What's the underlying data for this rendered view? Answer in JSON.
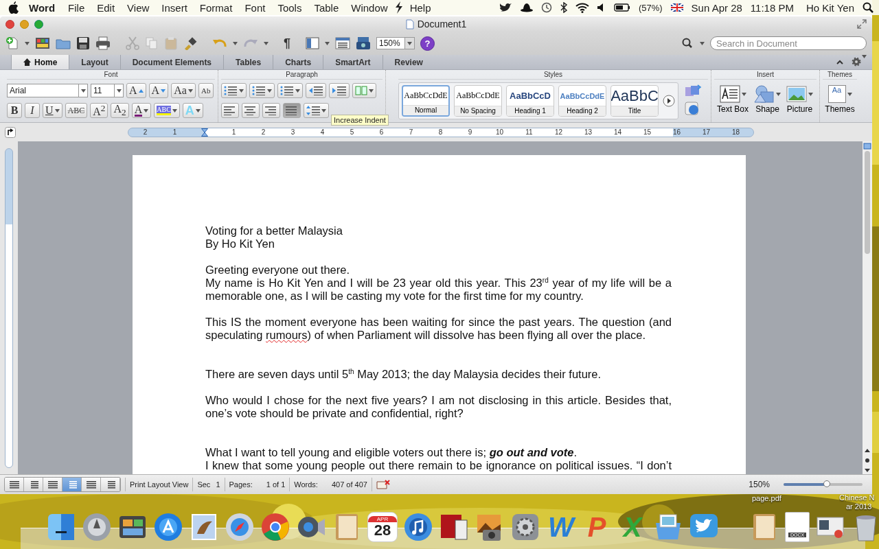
{
  "menu_bar": {
    "app": "Word",
    "menus": [
      "File",
      "Edit",
      "View",
      "Insert",
      "Format",
      "Font",
      "Tools",
      "Table",
      "Window"
    ],
    "help": "Help",
    "battery": "(57%)",
    "date": "Sun Apr 28",
    "time": "11:18 PM",
    "user": "Ho Kit Yen"
  },
  "window": {
    "title": "Document1"
  },
  "toolbar": {
    "formatting_marks": "¶",
    "zoom": "150%",
    "help": "?",
    "search": {
      "placeholder": "Search in Document"
    }
  },
  "ribbon": {
    "tabs": [
      {
        "label": "Home",
        "selected": true
      },
      {
        "label": "Layout",
        "selected": false
      },
      {
        "label": "Document Elements",
        "selected": false
      },
      {
        "label": "Tables",
        "selected": false
      },
      {
        "label": "Charts",
        "selected": false
      },
      {
        "label": "SmartArt",
        "selected": false
      },
      {
        "label": "Review",
        "selected": false
      }
    ],
    "font": {
      "title": "Font",
      "font_name": "Arial",
      "font_size": "11",
      "row1": [
        {
          "kind": "grow",
          "label": "A"
        },
        {
          "kind": "shrink",
          "label": "A"
        },
        {
          "kind": "case",
          "label": "Aa"
        },
        {
          "kind": "clear",
          "label": "Ab"
        }
      ],
      "row2": [
        {
          "kind": "bold",
          "label": "B"
        },
        {
          "kind": "italic",
          "label": "I"
        },
        {
          "kind": "underline",
          "label": "U"
        },
        {
          "kind": "strike",
          "label": "ABC"
        },
        {
          "kind": "superscript",
          "label": "A$^{2}$"
        },
        {
          "kind": "subscript",
          "label": "A$_{2}$"
        },
        {
          "kind": "font_color",
          "label": "A"
        },
        {
          "kind": "highlight",
          "label": "ABC"
        },
        {
          "kind": "effects",
          "label": "A"
        }
      ]
    },
    "paragraph": {
      "title": "Paragraph",
      "alignments": [
        {
          "selected": false
        },
        {
          "selected": false
        },
        {
          "selected": false
        },
        {
          "selected": true
        }
      ]
    },
    "tooltip": "Increase Indent",
    "styles": {
      "title": "Styles",
      "items": [
        {
          "kind": "normal",
          "sample": "AaBbCcDdE",
          "name": "Normal",
          "selected": true
        },
        {
          "kind": "no_spacing",
          "sample": "AaBbCcDdE",
          "name": "No Spacing",
          "selected": false
        },
        {
          "kind": "heading1",
          "sample": "AaBbCcD",
          "name": "Heading 1",
          "selected": false
        },
        {
          "kind": "heading2",
          "sample": "AaBbCcDdE",
          "name": "Heading 2",
          "selected": false
        },
        {
          "kind": "title",
          "sample": "AaBbC",
          "name": "Title",
          "selected": false
        }
      ]
    },
    "insert": {
      "title": "Insert",
      "items": [
        {
          "kind": "text_box",
          "label": "Text Box"
        },
        {
          "kind": "shape",
          "label": "Shape"
        },
        {
          "kind": "picture",
          "label": "Picture"
        }
      ]
    },
    "themes": {
      "title": "Themes",
      "label": "Themes",
      "sample": "Aa"
    }
  },
  "ruler": {
    "numbers": [
      "2",
      "1",
      "1",
      "2",
      "3",
      "4",
      "5",
      "6",
      "7",
      "8",
      "9",
      "10",
      "11",
      "12",
      "13",
      "14",
      "15",
      "16",
      "17",
      "18"
    ]
  },
  "document": {
    "paragraphs": [
      {
        "kind": "text",
        "text": "Voting for a better Malaysia"
      },
      {
        "kind": "text",
        "text": "By Ho Kit Yen"
      },
      {
        "kind": "blank"
      },
      {
        "kind": "text",
        "text": "Greeting everyone out there."
      },
      {
        "kind": "text",
        "text": "My name is Ho Kit Yen and I will be 23 year old this year. This 23$^{rd}$ year of my life will be a memorable one, as I will be casting my vote for the first time for my country."
      },
      {
        "kind": "blank"
      },
      {
        "kind": "runs",
        "runs": [
          {
            "text": "This IS the moment everyone has been waiting for since the past years. The question (and speculating ",
            "misspelled": false
          },
          {
            "text": "rumours",
            "misspelled": true
          },
          {
            "text": ") of when Parliament will dissolve has been flying all over the place.",
            "misspelled": false
          }
        ]
      },
      {
        "kind": "blank"
      },
      {
        "kind": "blank"
      },
      {
        "kind": "text",
        "text": "There are seven days until 5$^{th}$ May 2013; the day Malaysia decides their future."
      },
      {
        "kind": "blank"
      },
      {
        "kind": "text",
        "text": "Who would I chose for the next five years? I am not disclosing in this article. Besides that, one’s vote should be private and confidential, right?"
      },
      {
        "kind": "blank"
      },
      {
        "kind": "blank"
      },
      {
        "kind": "emphasis",
        "runs": [
          {
            "text": "What I want to tell young and eligible voters out there is; ",
            "bold_italic": false
          },
          {
            "text": "go out and vote",
            "bold_italic": true
          },
          {
            "text": ".",
            "bold_italic": false
          }
        ]
      },
      {
        "kind": "cut",
        "text": "I knew that some young people out there remain to be ignorance on political issues. “I don’t"
      }
    ]
  },
  "status_bar": {
    "views": [
      {
        "selected": false
      },
      {
        "selected": false
      },
      {
        "selected": false
      },
      {
        "selected": true
      },
      {
        "selected": false
      },
      {
        "selected": false
      }
    ],
    "view_name": "Print Layout View",
    "section_label": "Sec",
    "section": "1",
    "pages_label": "Pages:",
    "pages": "1 of 1",
    "words_label": "Words:",
    "words": "407 of 407",
    "zoom": "150%",
    "zoom_slider": {
      "level": 0.55
    }
  },
  "dock": {
    "calendar_month": "APR",
    "calendar_day": "28",
    "letters": [
      "W",
      "P",
      "X"
    ],
    "file_label": "DOCX"
  },
  "desktop": {
    "labels": [
      "page.pdf",
      "Chinese N",
      "ar 2013"
    ]
  }
}
